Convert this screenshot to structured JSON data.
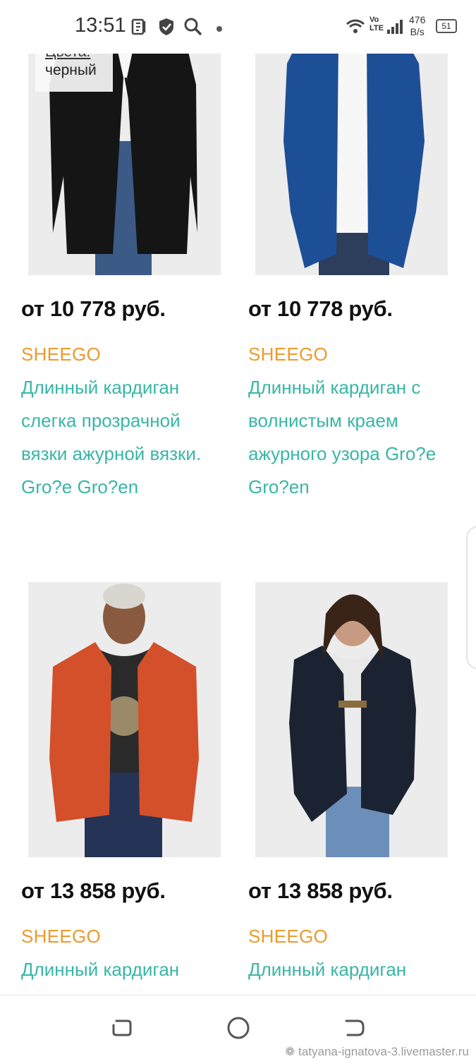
{
  "status_bar": {
    "time": "13:51",
    "icons": [
      "tiktok-icon",
      "shield-icon",
      "search-icon",
      "dot-icon"
    ],
    "network_label_top": "Vo",
    "network_label_bottom": "LTE",
    "speed_value": "476",
    "speed_unit": "B/s",
    "battery": "51"
  },
  "products": [
    {
      "price": "от 10 778 руб.",
      "brand": "SHEEGO",
      "name": "Длинный кардиган слегка прозрачной вязки ажурной вязки. Gro?e Gro?en",
      "image": "black-lace-cardigan-image",
      "colors_label": "Цвета:",
      "color_value": "черный"
    },
    {
      "price": "от 10 778 руб.",
      "brand": "SHEEGO",
      "name": "Длинный кардиган с волнистым краем ажурного узора Gro?e Gro?en",
      "image": "blue-lace-cardigan-image"
    },
    {
      "price": "от 13 858 руб.",
      "brand": "SHEEGO",
      "name": "Длинный кардиган",
      "image": "orange-knit-cardigan-image"
    },
    {
      "price": "от 13 858 руб.",
      "brand": "SHEEGO",
      "name": "Длинный кардиган",
      "image": "navy-knit-cardigan-image"
    }
  ],
  "navigation": {
    "buttons": [
      "recents-button",
      "home-button",
      "back-button"
    ],
    "watermark": "tatyana-ignatova-3.livemaster.ru"
  },
  "colors": {
    "price": "#111111",
    "brand": "#ec9a2c",
    "product_name": "#38b6a6"
  }
}
